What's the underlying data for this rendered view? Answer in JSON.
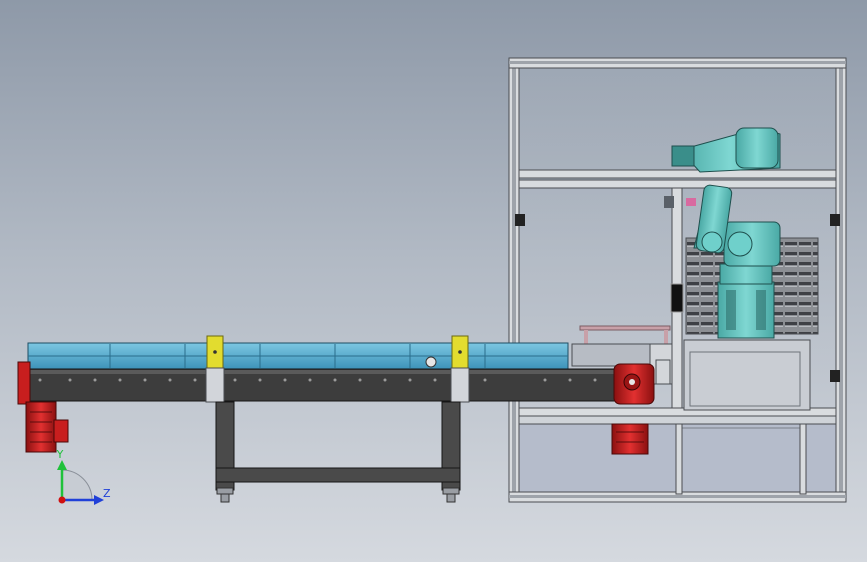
{
  "colors": {
    "conveyor_belt": "#5aaed0",
    "conveyor_body": "#3d3d3d",
    "frame": "#6e6e6e",
    "motor": "#d11f1f",
    "bracket": "#e6e03a",
    "robot": "#5ec3bf",
    "axis_y": "#1fc13a",
    "axis_z": "#2040d8",
    "axis_origin": "#d01010"
  },
  "coordinate_triad": {
    "y_label": "Y",
    "z_label": "Z"
  },
  "components": [
    "conveyor",
    "drive-motor-left",
    "conveyor-support-stand",
    "enclosure-frame",
    "robot-arm",
    "gearmotor-right",
    "pallet-rack"
  ]
}
